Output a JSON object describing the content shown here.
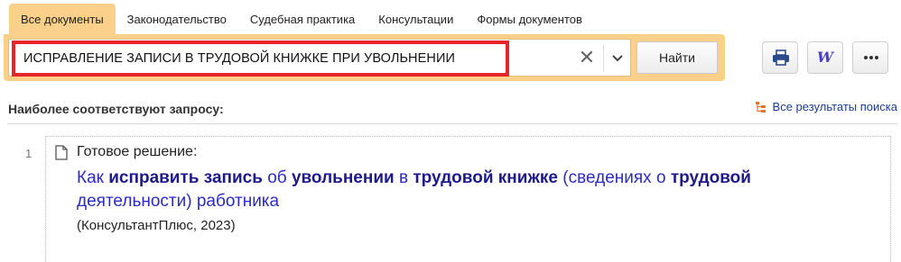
{
  "tabs": [
    {
      "label": "Все документы",
      "active": true
    },
    {
      "label": "Законодательство",
      "active": false
    },
    {
      "label": "Судебная практика",
      "active": false
    },
    {
      "label": "Консультации",
      "active": false
    },
    {
      "label": "Формы документов",
      "active": false
    }
  ],
  "search": {
    "query": "ИСПРАВЛЕНИЕ ЗАПИСИ В ТРУДОВОЙ КНИЖКЕ ПРИ УВОЛЬНЕНИИ",
    "find_label": "Найти",
    "clear_icon": "close-icon",
    "dropdown_icon": "chevron-down-icon"
  },
  "toolbar": {
    "print_icon": "printer-icon",
    "word_label": "W",
    "more_icon": "ellipsis-icon"
  },
  "results": {
    "header": "Наиболее соответствуют запросу:",
    "all_results_label": "Все результаты поиска",
    "items": [
      {
        "number": "1",
        "type": "Готовое решение:",
        "title_segments": [
          {
            "text": "Как ",
            "bold": false
          },
          {
            "text": "исправить запись",
            "bold": true
          },
          {
            "text": " об ",
            "bold": false
          },
          {
            "text": "увольнении",
            "bold": true
          },
          {
            "text": " в ",
            "bold": false
          },
          {
            "text": "трудовой книжке",
            "bold": true
          },
          {
            "text": " (сведениях о ",
            "bold": false
          },
          {
            "text": "трудовой",
            "bold": true
          },
          {
            "text": " деятельности) работника",
            "bold": false
          }
        ],
        "source": "(КонсультантПлюс, 2023)"
      }
    ]
  },
  "colors": {
    "accent": "#fbd08a",
    "highlight_border": "#e8252a",
    "link": "#2b2bc4",
    "link_bold": "#1f1a8a"
  }
}
